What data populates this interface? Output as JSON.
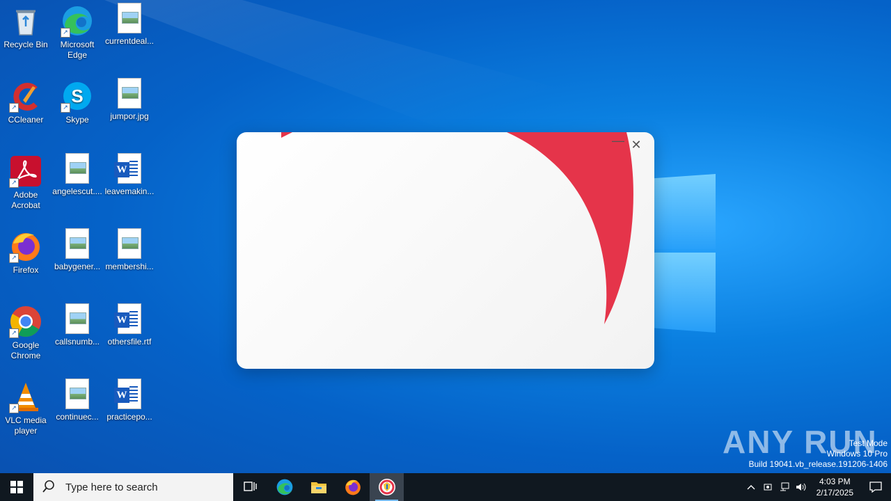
{
  "desktop": {
    "icons": [
      {
        "label": "Recycle Bin"
      },
      {
        "label": "Microsoft Edge"
      },
      {
        "label": "currentdeal..."
      },
      {
        "label": "CCleaner"
      },
      {
        "label": "Skype"
      },
      {
        "label": "jumpor.jpg"
      },
      {
        "label": "Adobe Acrobat"
      },
      {
        "label": "angelescut...."
      },
      {
        "label": "leavemakin..."
      },
      {
        "label": "Firefox"
      },
      {
        "label": "babygener..."
      },
      {
        "label": "membershi..."
      },
      {
        "label": "Google Chrome"
      },
      {
        "label": "callsnumb..."
      },
      {
        "label": "othersfile.rtf"
      },
      {
        "label": "VLC media player"
      },
      {
        "label": "continuec..."
      },
      {
        "label": "practicepo..."
      }
    ]
  },
  "dialog": {
    "minimize": "—",
    "close": "✕",
    "accent_color": "#e5344a"
  },
  "watermark": {
    "brand": "ANY RUN",
    "line1": "Test Mode",
    "line2": "Windows 10 Pro",
    "line3": "Build 19041.vb_release.191206-1406"
  },
  "taskbar": {
    "search_placeholder": "Type here to search",
    "time": "4:03 PM",
    "date": "2/17/2025"
  }
}
